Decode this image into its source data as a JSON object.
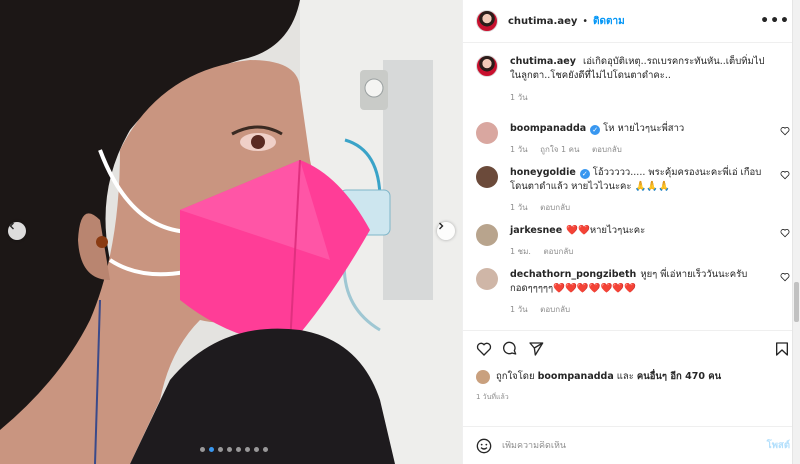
{
  "post": {
    "username": "chutima.aey",
    "separator": "•",
    "follow_label": "ติดตาม",
    "more_icon": "more-horizontal-icon"
  },
  "caption": {
    "username": "chutima.aey",
    "text": "เอ่เกิดอุบัติเหตุ..รถเบรคกระทันหัน..เต็บทิ่มไปในลูกตา..โชคยังดีที่ไม่ไปโดนตาดำคะ..",
    "time": "1 วัน"
  },
  "comments": [
    {
      "username": "boompanadda",
      "verified": true,
      "text": "โห หายไวๆนะพี่สาว",
      "time": "1 วัน",
      "likes": "ถูกใจ 1 คน",
      "reply": "ตอบกลับ",
      "avatar_color": "#d9a7a0"
    },
    {
      "username": "honeygoldie",
      "verified": true,
      "text": "โอ้ววววว..... พระคุ้มครองนะคะพี่เอ่ เกือบโดนตาดำแล้ว หายไวไวนะคะ 🙏🙏🙏",
      "time": "1 วัน",
      "likes": "",
      "reply": "ตอบกลับ",
      "avatar_color": "#6b4a3a"
    },
    {
      "username": "jarkesnee",
      "verified": false,
      "text": "❤️❤️หายไวๆนะคะ",
      "time": "1 ชม.",
      "likes": "",
      "reply": "ตอบกลับ",
      "avatar_color": "#b8a48d"
    },
    {
      "username": "dechathorn_pongzibeth",
      "verified": false,
      "text": "หูยๆ พี่เอ่หายเร็ววันนะครับ กอดๆๆๆๆๆ❤️❤️❤️❤️❤️❤️❤️",
      "time": "1 วัน",
      "likes": "",
      "reply": "ตอบกลับ",
      "avatar_color": "#cfb6a7"
    }
  ],
  "actions": {
    "liked_by_prefix": "ถูกใจโดย",
    "liked_by_user": "boompanadda",
    "liked_by_and": "และ",
    "liked_by_others": "คนอื่นๆ อีก 470 คน",
    "time_ago": "1 วันที่แล้ว"
  },
  "add_comment": {
    "placeholder": "เพิ่มความคิดเห็น",
    "post_label": "โพสต์"
  },
  "colors": {
    "accent": "#0095f6",
    "mask_pink": "#ff3d97",
    "border": "#efefef",
    "muted": "#8e8e8e"
  }
}
